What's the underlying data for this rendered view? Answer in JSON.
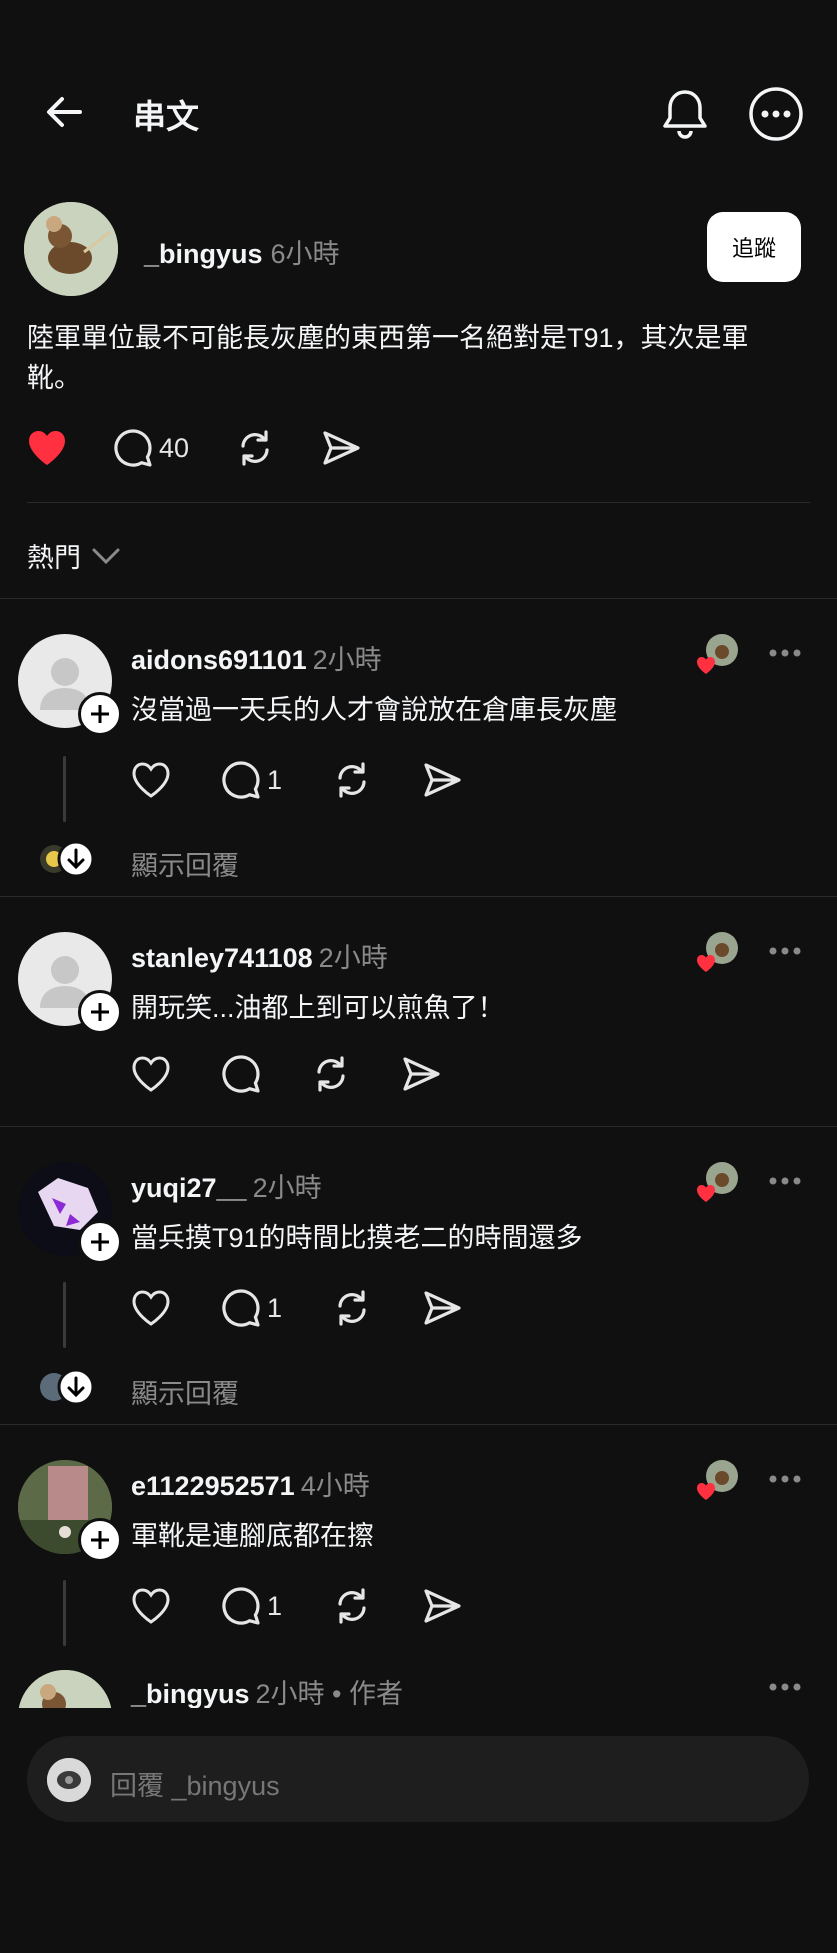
{
  "header": {
    "title": "串文"
  },
  "post": {
    "username": "_bingyus",
    "time": "6小時",
    "follow_label": "追蹤",
    "text": "陸軍單位最不可能長灰塵的東西第一名絕對是T91，其次是軍靴。",
    "replies_count": "40"
  },
  "sort": {
    "label": "熱門"
  },
  "comments": [
    {
      "username": "aidons691101",
      "time": "2小時",
      "text": "沒當過一天兵的人才會說放在倉庫長灰塵",
      "reply_count": "1",
      "show_replies": "顯示回覆"
    },
    {
      "username": "stanley741108",
      "time": "2小時",
      "text": "開玩笑...油都上到可以煎魚了！",
      "reply_count": ""
    },
    {
      "username": "yuqi27__",
      "time": "2小時",
      "text": "當兵摸T91的時間比摸老二的時間還多",
      "reply_count": "1",
      "show_replies": "顯示回覆"
    },
    {
      "username": "e1122952571",
      "time": "4小時",
      "text": "軍靴是連腳底都在擦",
      "reply_count": "1"
    },
    {
      "username": "_bingyus",
      "time": "2小時 • 作者"
    }
  ],
  "reply_input": {
    "placeholder": "回覆 _bingyus"
  },
  "colors": {
    "background": "#101010",
    "like_red": "#ff3040",
    "muted": "#8a8a8a"
  }
}
